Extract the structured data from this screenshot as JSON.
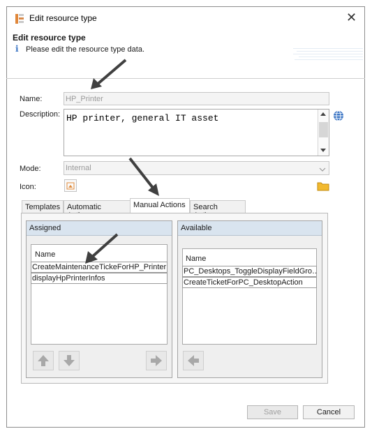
{
  "window": {
    "title": "Edit resource type",
    "close_glyph": "✕"
  },
  "header": {
    "title": "Edit resource type",
    "info_glyph": "i",
    "subtitle": "Please edit the resource type data."
  },
  "form": {
    "name_label": "Name:",
    "name_value": "HP_Printer",
    "description_label": "Description:",
    "description_value": "HP printer, general IT asset",
    "mode_label": "Mode:",
    "mode_value": "Internal",
    "icon_label": "Icon:"
  },
  "tabs": [
    {
      "label": "Templates",
      "active": false
    },
    {
      "label": "Automatic Actions",
      "active": false
    },
    {
      "label": "Manual Actions",
      "active": true
    },
    {
      "label": "Search Actions",
      "active": false
    }
  ],
  "assigned": {
    "title": "Assigned",
    "column": "Name",
    "rows": [
      "CreateMaintenanceTickeForHP_Printer",
      "displayHpPrinterInfos"
    ]
  },
  "available": {
    "title": "Available",
    "column": "Name",
    "rows": [
      "PC_Desktops_ToggleDisplayFieldGro…",
      "CreateTicketForPC_DesktopAction"
    ]
  },
  "footer": {
    "save_label": "Save",
    "cancel_label": "Cancel"
  },
  "icons": {
    "app": "resource-type-icon",
    "globe": "globe-icon",
    "folder": "folder-icon",
    "arrows": [
      "move-up-icon",
      "move-down-icon",
      "move-right-icon",
      "move-left-icon"
    ]
  },
  "colors": {
    "accent": "#3a74c4",
    "group_header": "#d9e4ef",
    "annotation_arrow": "#404040"
  }
}
